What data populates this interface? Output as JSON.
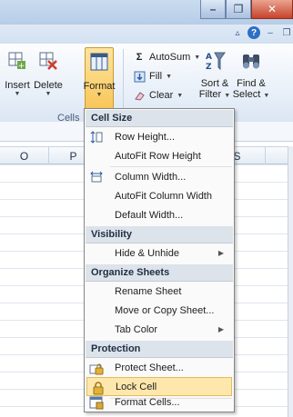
{
  "window": {
    "minimize_glyph": "–",
    "restore_glyph": "❐",
    "close_glyph": "✕"
  },
  "tabstrip_icons": [
    "caret-up-icon",
    "help-icon",
    "minimize-ribbon-icon",
    "restore-ribbon-icon"
  ],
  "ribbon": {
    "insert_label": "Insert",
    "delete_label": "Delete",
    "format_label": "Format",
    "cells_group_label": "Cells",
    "autosum_label": "AutoSum",
    "fill_label": "Fill",
    "clear_label": "Clear",
    "sort_label": "Sort &",
    "sort_label2": "Filter",
    "find_label": "Find &",
    "find_label2": "Select"
  },
  "columns": [
    "O",
    "P",
    "S"
  ],
  "menu": {
    "sections": {
      "cell_size": "Cell Size",
      "visibility": "Visibility",
      "organize": "Organize Sheets",
      "protection": "Protection"
    },
    "items": {
      "row_height": "Row Height...",
      "autofit_row": "AutoFit Row Height",
      "col_width": "Column Width...",
      "autofit_col": "AutoFit Column Width",
      "default_width": "Default Width...",
      "hide_unhide": "Hide & Unhide",
      "rename": "Rename Sheet",
      "move_copy": "Move or Copy Sheet...",
      "tab_color": "Tab Color",
      "protect": "Protect Sheet...",
      "lock": "Lock Cell",
      "format_cells": "Format Cells..."
    }
  },
  "colors": {
    "accent": "#f8c658",
    "ribbon_bg": "#e6eef8",
    "menu_header": "#dde3ea"
  }
}
